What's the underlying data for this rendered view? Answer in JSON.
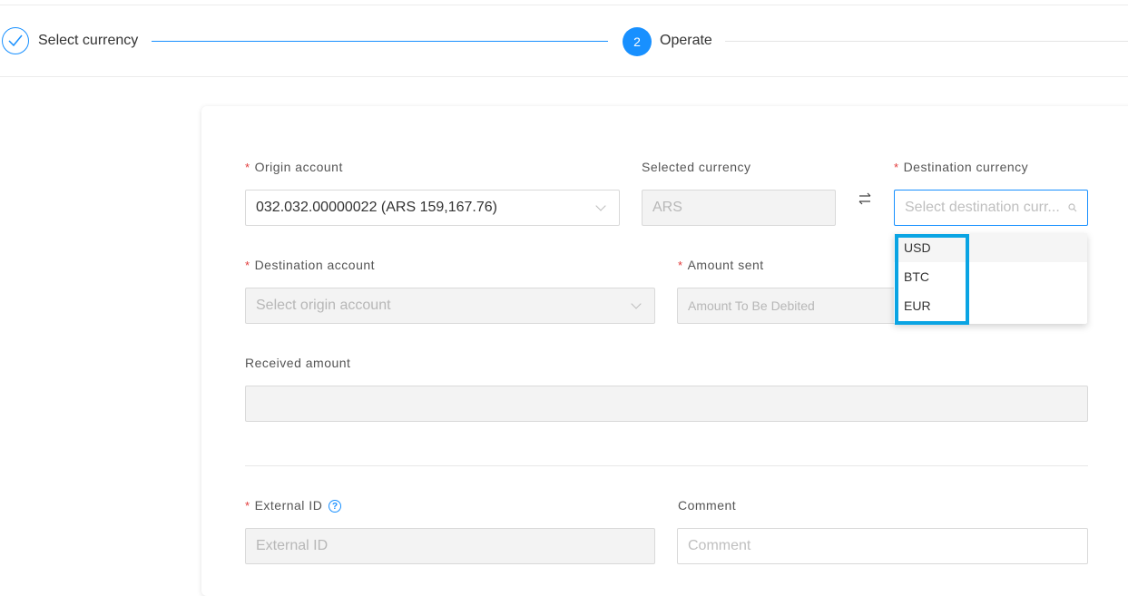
{
  "steps": [
    {
      "label": "Select currency",
      "status": "done"
    },
    {
      "number": "2",
      "label": "Operate",
      "status": "current"
    }
  ],
  "form": {
    "origin_account": {
      "label": "Origin account",
      "value": "032.032.00000022 (ARS 159,167.76)"
    },
    "selected_currency": {
      "label": "Selected currency",
      "value": "ARS"
    },
    "destination_currency": {
      "label": "Destination currency",
      "placeholder": "Select destination curr..."
    },
    "destination_account": {
      "label": "Destination account",
      "placeholder": "Select origin account"
    },
    "amount_sent": {
      "label": "Amount sent",
      "placeholder": "Amount To Be Debited"
    },
    "received_amount": {
      "label": "Received amount",
      "value": ""
    },
    "external_id": {
      "label": "External ID",
      "placeholder": "External ID"
    },
    "comment": {
      "label": "Comment",
      "placeholder": "Comment"
    }
  },
  "currency_options": [
    "USD",
    "BTC",
    "EUR"
  ],
  "icons": {
    "swap": "swap-icon",
    "search": "search-icon",
    "check": "check-icon",
    "help": "help-icon",
    "chevron": "chevron-down-icon"
  },
  "colors": {
    "primary": "#1890ff",
    "required": "#e23b3b",
    "highlight": "#0aa4e3"
  }
}
